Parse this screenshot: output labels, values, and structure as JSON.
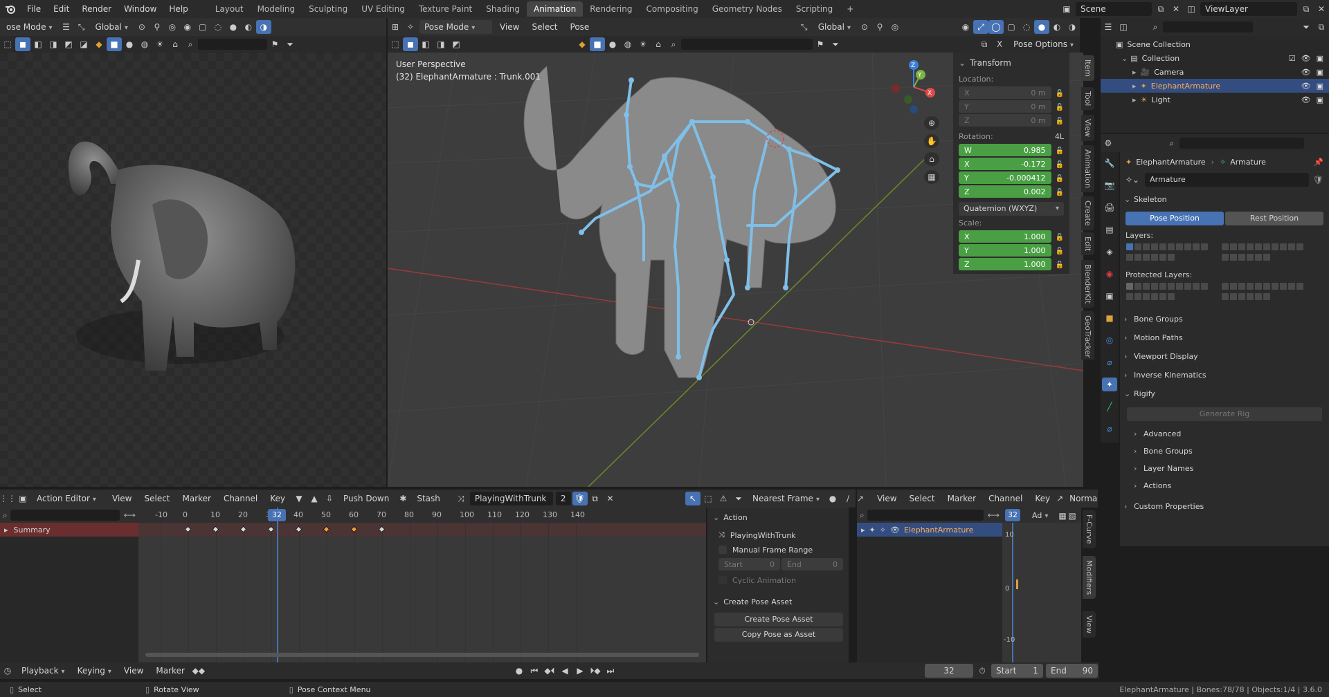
{
  "menubar": {
    "items": [
      "File",
      "Edit",
      "Render",
      "Window",
      "Help"
    ],
    "workspaces": [
      "Layout",
      "Modeling",
      "Sculpting",
      "UV Editing",
      "Texture Paint",
      "Shading",
      "Animation",
      "Rendering",
      "Compositing",
      "Geometry Nodes",
      "Scripting"
    ],
    "active_workspace": "Animation",
    "scene": "Scene",
    "view_layer": "ViewLayer"
  },
  "left_view": {
    "mode": "ose Mode",
    "orientation": "Global"
  },
  "main_view": {
    "mode": "Pose Mode",
    "menus": [
      "View",
      "Select",
      "Pose"
    ],
    "orientation": "Global",
    "pose_options": "Pose Options",
    "overlay_title": "User Perspective",
    "overlay_subtitle": "(32) ElephantArmature : Trunk.001",
    "axis_x": "X",
    "axis_y": "Y",
    "axis_z": "Z"
  },
  "side_tabs": [
    "Item",
    "Tool",
    "View",
    "Animation",
    "Create",
    "Edit",
    "BlenderKit",
    "GeoTracker"
  ],
  "transform": {
    "title": "Transform",
    "location_label": "Location:",
    "location": [
      {
        "axis": "X",
        "value": "0 m"
      },
      {
        "axis": "Y",
        "value": "0 m"
      },
      {
        "axis": "Z",
        "value": "0 m"
      }
    ],
    "rotation_label": "Rotation:",
    "rotation_mode_short": "4L",
    "rotation": [
      {
        "axis": "W",
        "value": "0.985"
      },
      {
        "axis": "X",
        "value": "-0.172"
      },
      {
        "axis": "Y",
        "value": "-0.000412"
      },
      {
        "axis": "Z",
        "value": "0.002"
      }
    ],
    "rotation_mode": "Quaternion (WXYZ)",
    "scale_label": "Scale:",
    "scale": [
      {
        "axis": "X",
        "value": "1.000"
      },
      {
        "axis": "Y",
        "value": "1.000"
      },
      {
        "axis": "Z",
        "value": "1.000"
      }
    ]
  },
  "outliner": {
    "root": "Scene Collection",
    "collection": "Collection",
    "items": [
      {
        "name": "Camera",
        "icon": "camera-icon"
      },
      {
        "name": "ElephantArmature",
        "icon": "armature-icon",
        "selected": true
      },
      {
        "name": "Light",
        "icon": "light-icon"
      }
    ]
  },
  "properties": {
    "breadcrumb_object": "ElephantArmature",
    "breadcrumb_data": "Armature",
    "datablock_name": "Armature",
    "skeleton": "Skeleton",
    "pose_position": "Pose Position",
    "rest_position": "Rest Position",
    "layers": "Layers:",
    "protected_layers": "Protected Layers:",
    "sections": [
      "Bone Groups",
      "Motion Paths",
      "Viewport Display",
      "Inverse Kinematics"
    ],
    "rigify": "Rigify",
    "generate_rig": "Generate Rig",
    "rigify_subsections": [
      "Advanced",
      "Bone Groups",
      "Layer Names",
      "Actions"
    ],
    "custom_properties": "Custom Properties"
  },
  "action_editor": {
    "editor_type": "Action Editor",
    "menus": [
      "View",
      "Select",
      "Marker",
      "Channel",
      "Key"
    ],
    "push_down": "Push Down",
    "stash": "Stash",
    "action_name": "PlayingWithTrunk",
    "user_count": "2",
    "snap": "Nearest Frame",
    "ruler": [
      "-10",
      "0",
      "10",
      "20",
      "30",
      "40",
      "50",
      "60",
      "70",
      "80",
      "90",
      "100",
      "110",
      "120",
      "130",
      "140"
    ],
    "current_frame": "32",
    "summary": "Summary",
    "keyframes": [
      0,
      10,
      20,
      30,
      40,
      50,
      60,
      70
    ],
    "selected_keyframes": [
      50,
      60
    ],
    "sidebar": {
      "action_title": "Action",
      "action_name": "PlayingWithTrunk",
      "manual_frame_range": "Manual Frame Range",
      "start_label": "Start",
      "start_value": "0",
      "end_label": "End",
      "end_value": "0",
      "cyclic": "Cyclic Animation",
      "create_pose_asset_title": "Create Pose Asset",
      "create_pose_asset": "Create Pose Asset",
      "copy_pose_as_asset": "Copy Pose as Asset"
    }
  },
  "graph_editor": {
    "menus": [
      "View",
      "Select",
      "Marker",
      "Channel",
      "Key"
    ],
    "normalize": "Normaliz",
    "channel": "ElephantArmature",
    "current_frame": "32",
    "ad": "Ad",
    "y_labels": [
      "10",
      "0",
      "-10"
    ],
    "tabs": [
      "F-Curve",
      "Modifiers",
      "View"
    ]
  },
  "timeline": {
    "menus": [
      "Playback",
      "Keying",
      "View",
      "Marker"
    ],
    "current_frame": "32",
    "start_label": "Start",
    "start": "1",
    "end_label": "End",
    "end": "90"
  },
  "statusbar": {
    "select": "Select",
    "rotate_view": "Rotate View",
    "context_menu": "Pose Context Menu",
    "stats": "ElephantArmature | Bones:78/78 | Objects:1/4 | 3.6.0"
  },
  "colors": {
    "accent": "#4772b3",
    "bone": "#7fbfe8",
    "green_field": "#4a9f44",
    "keyframe": "#d8d8d8",
    "keyframe_selected": "#f0a040",
    "playhead": "#4772b3"
  }
}
